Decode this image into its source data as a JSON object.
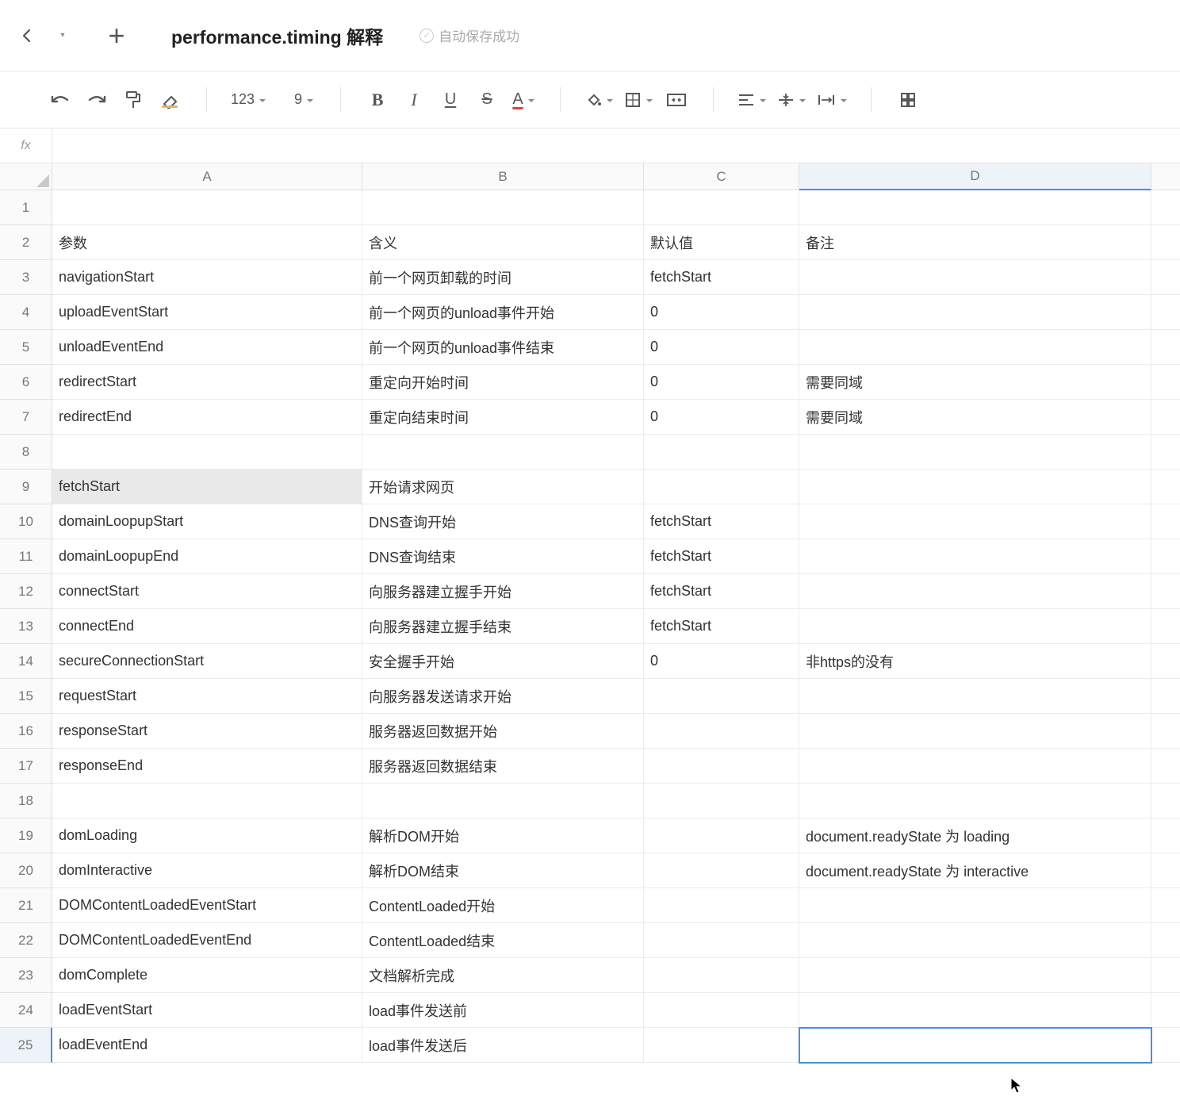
{
  "header": {
    "doc_title": "performance.timing 解释",
    "save_status": "自动保存成功"
  },
  "toolbar": {
    "number_format": "123",
    "font_size": "9"
  },
  "formula_bar": {
    "fx_label": "fx",
    "value": ""
  },
  "columns": [
    "A",
    "B",
    "C",
    "D",
    ""
  ],
  "selection": {
    "highlighted_cell": {
      "row": 9,
      "col": "A"
    },
    "active_cell": {
      "row": 25,
      "col": "D"
    }
  },
  "rows": [
    {
      "n": 1,
      "A": "",
      "B": "",
      "C": "",
      "D": ""
    },
    {
      "n": 2,
      "A": "参数",
      "B": "含义",
      "C": "默认值",
      "D": "备注"
    },
    {
      "n": 3,
      "A": "navigationStart",
      "B": "前一个网页卸载的时间",
      "C": "fetchStart",
      "D": ""
    },
    {
      "n": 4,
      "A": "uploadEventStart",
      "B": "前一个网页的unload事件开始",
      "C": "0",
      "D": ""
    },
    {
      "n": 5,
      "A": "unloadEventEnd",
      "B": "前一个网页的unload事件结束",
      "C": "0",
      "D": ""
    },
    {
      "n": 6,
      "A": "redirectStart",
      "B": "重定向开始时间",
      "C": "0",
      "D": "需要同域"
    },
    {
      "n": 7,
      "A": "redirectEnd",
      "B": "重定向结束时间",
      "C": "0",
      "D": "需要同域"
    },
    {
      "n": 8,
      "A": "",
      "B": "",
      "C": "",
      "D": ""
    },
    {
      "n": 9,
      "A": "fetchStart",
      "B": "开始请求网页",
      "C": "",
      "D": ""
    },
    {
      "n": 10,
      "A": "domainLoopupStart",
      "B": "DNS查询开始",
      "C": "fetchStart",
      "D": ""
    },
    {
      "n": 11,
      "A": "domainLoopupEnd",
      "B": "DNS查询结束",
      "C": "fetchStart",
      "D": ""
    },
    {
      "n": 12,
      "A": "connectStart",
      "B": "向服务器建立握手开始",
      "C": "fetchStart",
      "D": ""
    },
    {
      "n": 13,
      "A": "connectEnd",
      "B": "向服务器建立握手结束",
      "C": "fetchStart",
      "D": ""
    },
    {
      "n": 14,
      "A": "secureConnectionStart",
      "B": "安全握手开始",
      "C": "0",
      "D": "非https的没有"
    },
    {
      "n": 15,
      "A": "requestStart",
      "B": "向服务器发送请求开始",
      "C": "",
      "D": ""
    },
    {
      "n": 16,
      "A": "responseStart",
      "B": "服务器返回数据开始",
      "C": "",
      "D": ""
    },
    {
      "n": 17,
      "A": "responseEnd",
      "B": "服务器返回数据结束",
      "C": "",
      "D": ""
    },
    {
      "n": 18,
      "A": "",
      "B": "",
      "C": "",
      "D": ""
    },
    {
      "n": 19,
      "A": "domLoading",
      "B": "解析DOM开始",
      "C": "",
      "D": "document.readyState 为 loading"
    },
    {
      "n": 20,
      "A": "domInteractive",
      "B": "解析DOM结束",
      "C": "",
      "D": "document.readyState 为 interactive"
    },
    {
      "n": 21,
      "A": "DOMContentLoadedEventStart",
      "B": "ContentLoaded开始",
      "C": "",
      "D": ""
    },
    {
      "n": 22,
      "A": "DOMContentLoadedEventEnd",
      "B": "ContentLoaded结束",
      "C": "",
      "D": ""
    },
    {
      "n": 23,
      "A": "domComplete",
      "B": "文档解析完成",
      "C": "",
      "D": ""
    },
    {
      "n": 24,
      "A": "loadEventStart",
      "B": "load事件发送前",
      "C": "",
      "D": ""
    },
    {
      "n": 25,
      "A": "loadEventEnd",
      "B": "load事件发送后",
      "C": "",
      "D": ""
    }
  ]
}
